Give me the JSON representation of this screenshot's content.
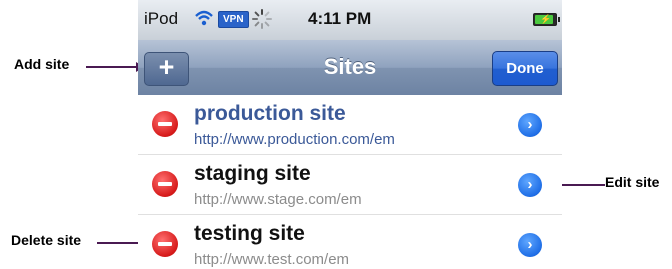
{
  "status_bar": {
    "carrier": "iPod",
    "vpn_label": "VPN",
    "time": "4:11 PM",
    "battery_level": 0.9
  },
  "nav_bar": {
    "add_label": "+",
    "title": "Sites",
    "done_label": "Done"
  },
  "sites": [
    {
      "name": "production site",
      "url": "http://www.production.com/em",
      "name_color": "#3b5998",
      "url_color": "#3b5998"
    },
    {
      "name": "staging site",
      "url": "http://www.stage.com/em",
      "name_color": "#111111",
      "url_color": "#8c8c8c"
    },
    {
      "name": "testing site",
      "url": "http://www.test.com/em",
      "name_color": "#111111",
      "url_color": "#8c8c8c"
    }
  ],
  "disclosure_glyph": "›",
  "annotations": {
    "add_site": "Add site",
    "edit_site": "Edit site",
    "delete_site": "Delete site"
  },
  "colors": {
    "arrow": "#4a1a52",
    "done_button": "#2a66d6",
    "delete_icon": "#d61a1a",
    "disclosure_icon": "#1f6ee6"
  }
}
